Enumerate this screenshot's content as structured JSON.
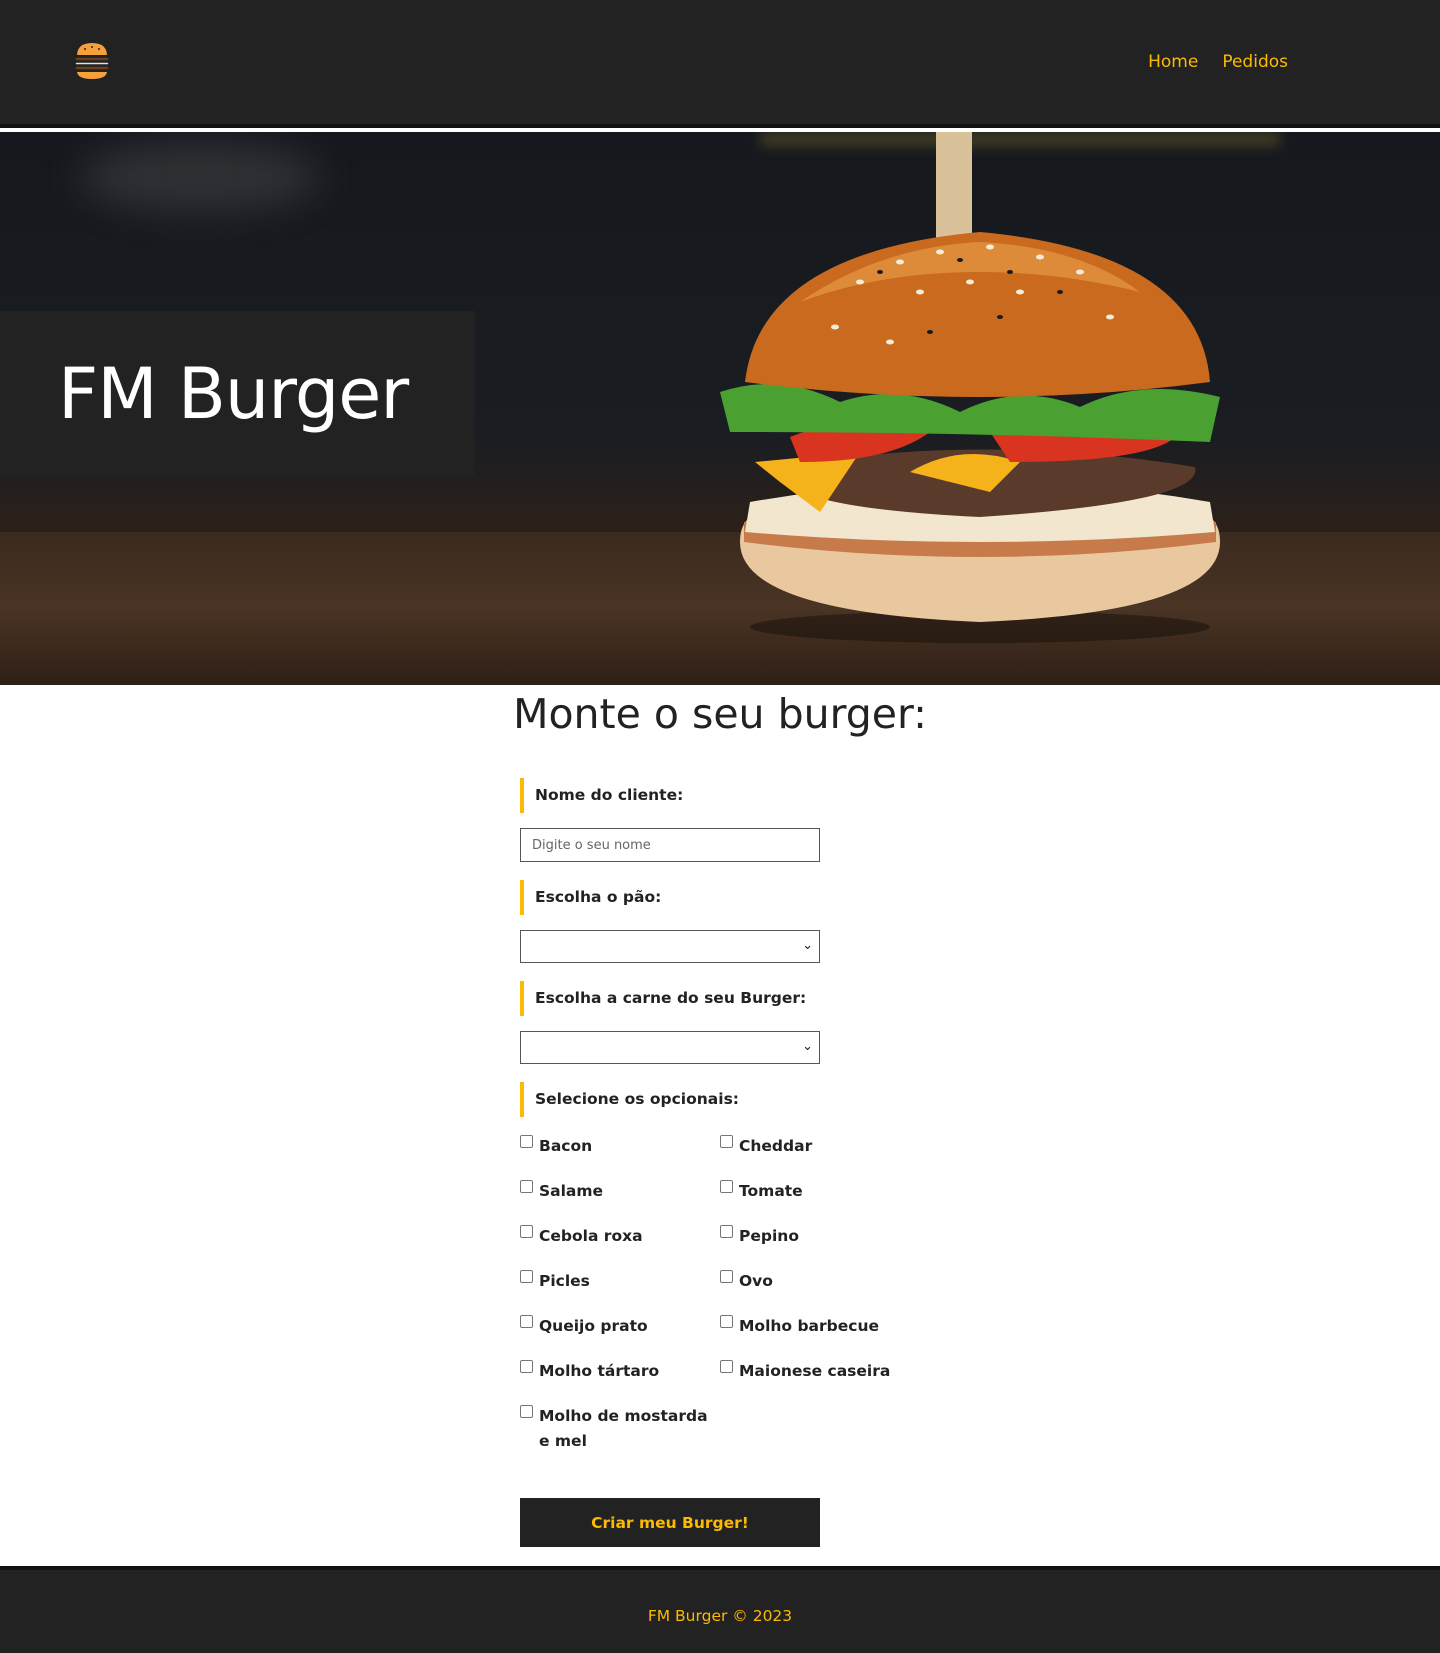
{
  "nav": {
    "logo_icon": "burger-icon",
    "links": [
      {
        "label": "Home"
      },
      {
        "label": "Pedidos"
      }
    ]
  },
  "hero": {
    "title": "FM Burger"
  },
  "main": {
    "title": "Monte o seu burger:"
  },
  "form": {
    "name_label": "Nome do cliente:",
    "name_placeholder": "Digite o seu nome",
    "name_value": "",
    "bread_label": "Escolha o pão:",
    "bread_selected": "",
    "meat_label": "Escolha a carne do seu Burger:",
    "meat_selected": "",
    "options_label": "Selecione os opcionais:",
    "options": [
      {
        "label": "Bacon",
        "checked": false
      },
      {
        "label": "Cheddar",
        "checked": false
      },
      {
        "label": "Salame",
        "checked": false
      },
      {
        "label": "Tomate",
        "checked": false
      },
      {
        "label": "Cebola roxa",
        "checked": false
      },
      {
        "label": "Pepino",
        "checked": false
      },
      {
        "label": "Picles",
        "checked": false
      },
      {
        "label": "Ovo",
        "checked": false
      },
      {
        "label": "Queijo prato",
        "checked": false
      },
      {
        "label": "Molho barbecue",
        "checked": false
      },
      {
        "label": "Molho tártaro",
        "checked": false
      },
      {
        "label": "Maionese caseira",
        "checked": false
      },
      {
        "label": "Molho de mostarda e mel",
        "checked": false
      }
    ],
    "submit_label": "Criar meu Burger!"
  },
  "footer": {
    "text": "FM Burger © 2023"
  },
  "colors": {
    "accent": "#fcba03",
    "dark": "#222222",
    "background": "#ffffff"
  }
}
